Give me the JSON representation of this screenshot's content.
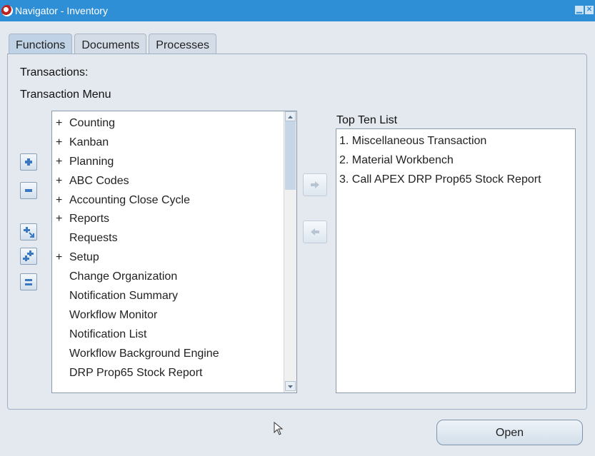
{
  "window": {
    "title": "Navigator - Inventory"
  },
  "tabs": [
    {
      "label": "Functions",
      "active": true
    },
    {
      "label": "Documents",
      "active": false
    },
    {
      "label": "Processes",
      "active": false
    }
  ],
  "labels": {
    "transactions": "Transactions:",
    "transaction_menu": "Transaction Menu",
    "top_ten": "Top Ten List"
  },
  "menu": {
    "items": [
      {
        "label": "Counting",
        "expander": "+"
      },
      {
        "label": "Kanban",
        "expander": "+"
      },
      {
        "label": "Planning",
        "expander": "+"
      },
      {
        "label": "ABC Codes",
        "expander": "+"
      },
      {
        "label": "Accounting Close Cycle",
        "expander": "+"
      },
      {
        "label": "Reports",
        "expander": "+"
      },
      {
        "label": "Requests",
        "expander": ""
      },
      {
        "label": "Setup",
        "expander": "+"
      },
      {
        "label": "Change Organization",
        "expander": ""
      },
      {
        "label": "Notification Summary",
        "expander": ""
      },
      {
        "label": "Workflow Monitor",
        "expander": ""
      },
      {
        "label": "Notification List",
        "expander": ""
      },
      {
        "label": "Workflow Background Engine",
        "expander": ""
      },
      {
        "label": "DRP Prop65 Stock Report",
        "expander": ""
      }
    ]
  },
  "top_ten": {
    "items": [
      "1. Miscellaneous Transaction",
      "2. Material Workbench",
      "3. Call APEX DRP Prop65 Stock Report"
    ]
  },
  "buttons": {
    "open": "Open"
  },
  "colors": {
    "titlebar": "#2e8fd6",
    "icon_blue": "#3a78c2",
    "arrow_gray": "#b8c4d2"
  }
}
